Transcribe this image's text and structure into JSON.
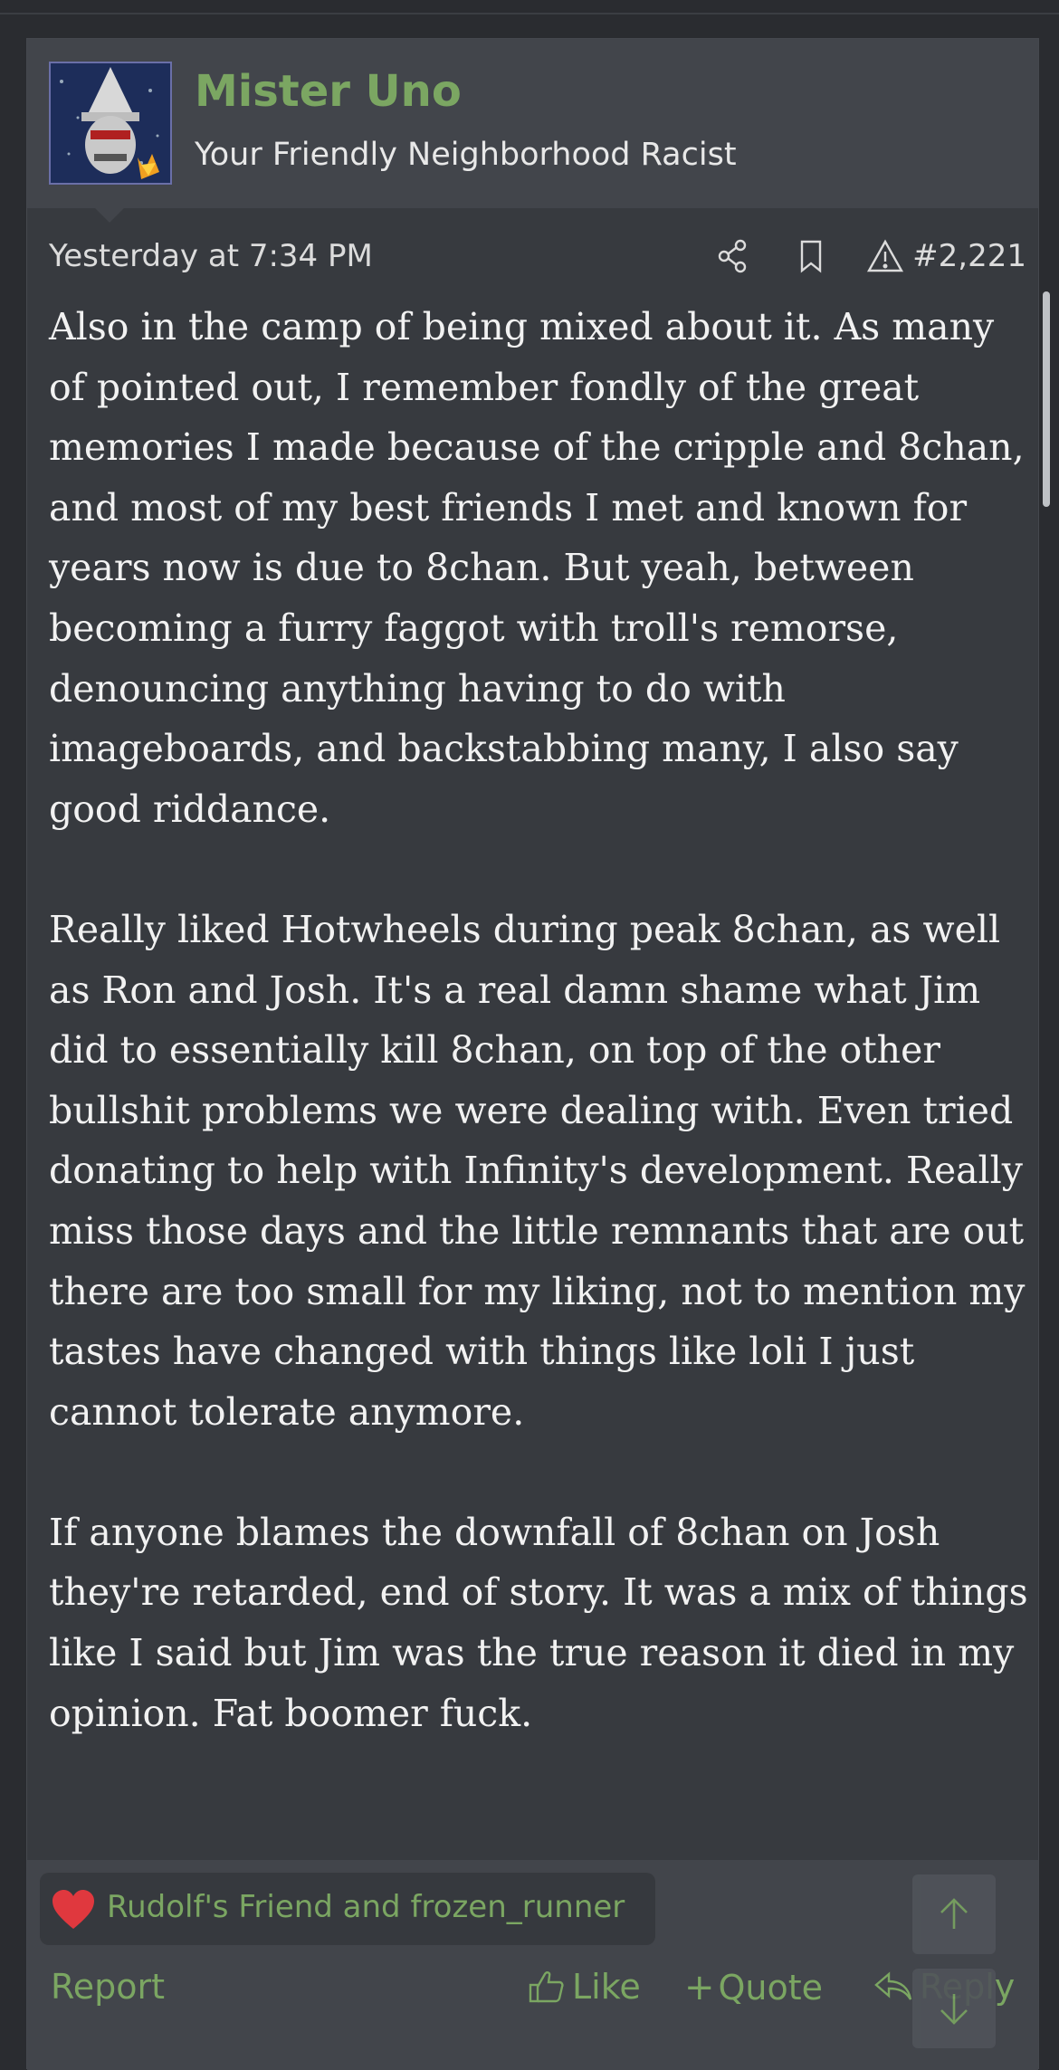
{
  "post": {
    "author": "Mister Uno",
    "user_title": "Your Friendly Neighborhood Racist",
    "timestamp": "Yesterday at 7:34 PM",
    "post_number": "#2,221",
    "paragraphs": [
      "Also in the camp of being mixed about it. As many of pointed out, I remember fondly of the great memories I made because of the cripple and 8chan, and most of my best friends I met and known for years now is due to 8chan. But yeah, between becoming a furry faggot with troll's remorse, denouncing anything having to do with imageboards, and backstabbing many, I also say good riddance.",
      "Really liked Hotwheels during peak 8chan, as well as Ron and Josh. It's a real damn shame what Jim did to essentially kill 8chan, on top of the other bullshit problems we were dealing with. Even tried donating to help with Infinity's development. Really miss those days and the little remnants that are out there are too small for my liking, not to mention my tastes have changed with things like loli I just cannot tolerate anymore.",
      "If anyone blames the downfall of 8chan on Josh they're retarded, end of story. It was a mix of things like I said but Jim was the true reason it died in my opinion. Fat boomer fuck."
    ],
    "meta_icons": [
      "share-icon",
      "bookmark-icon",
      "warning-icon"
    ]
  },
  "reactions": {
    "icon": "heart-icon",
    "text": "Rudolf's Friend and frozen_runner"
  },
  "actions": {
    "report": "Report",
    "like": "Like",
    "quote": "Quote",
    "reply": "Reply"
  },
  "scroll_buttons": [
    "arrow-up-icon",
    "arrow-down-icon"
  ],
  "colors": {
    "accent": "#7ba662",
    "background": "#2a2c30",
    "post_bg": "#373a3f",
    "header_bg": "#42454b",
    "text": "#f2f2f2",
    "heart": "#e0383e"
  }
}
